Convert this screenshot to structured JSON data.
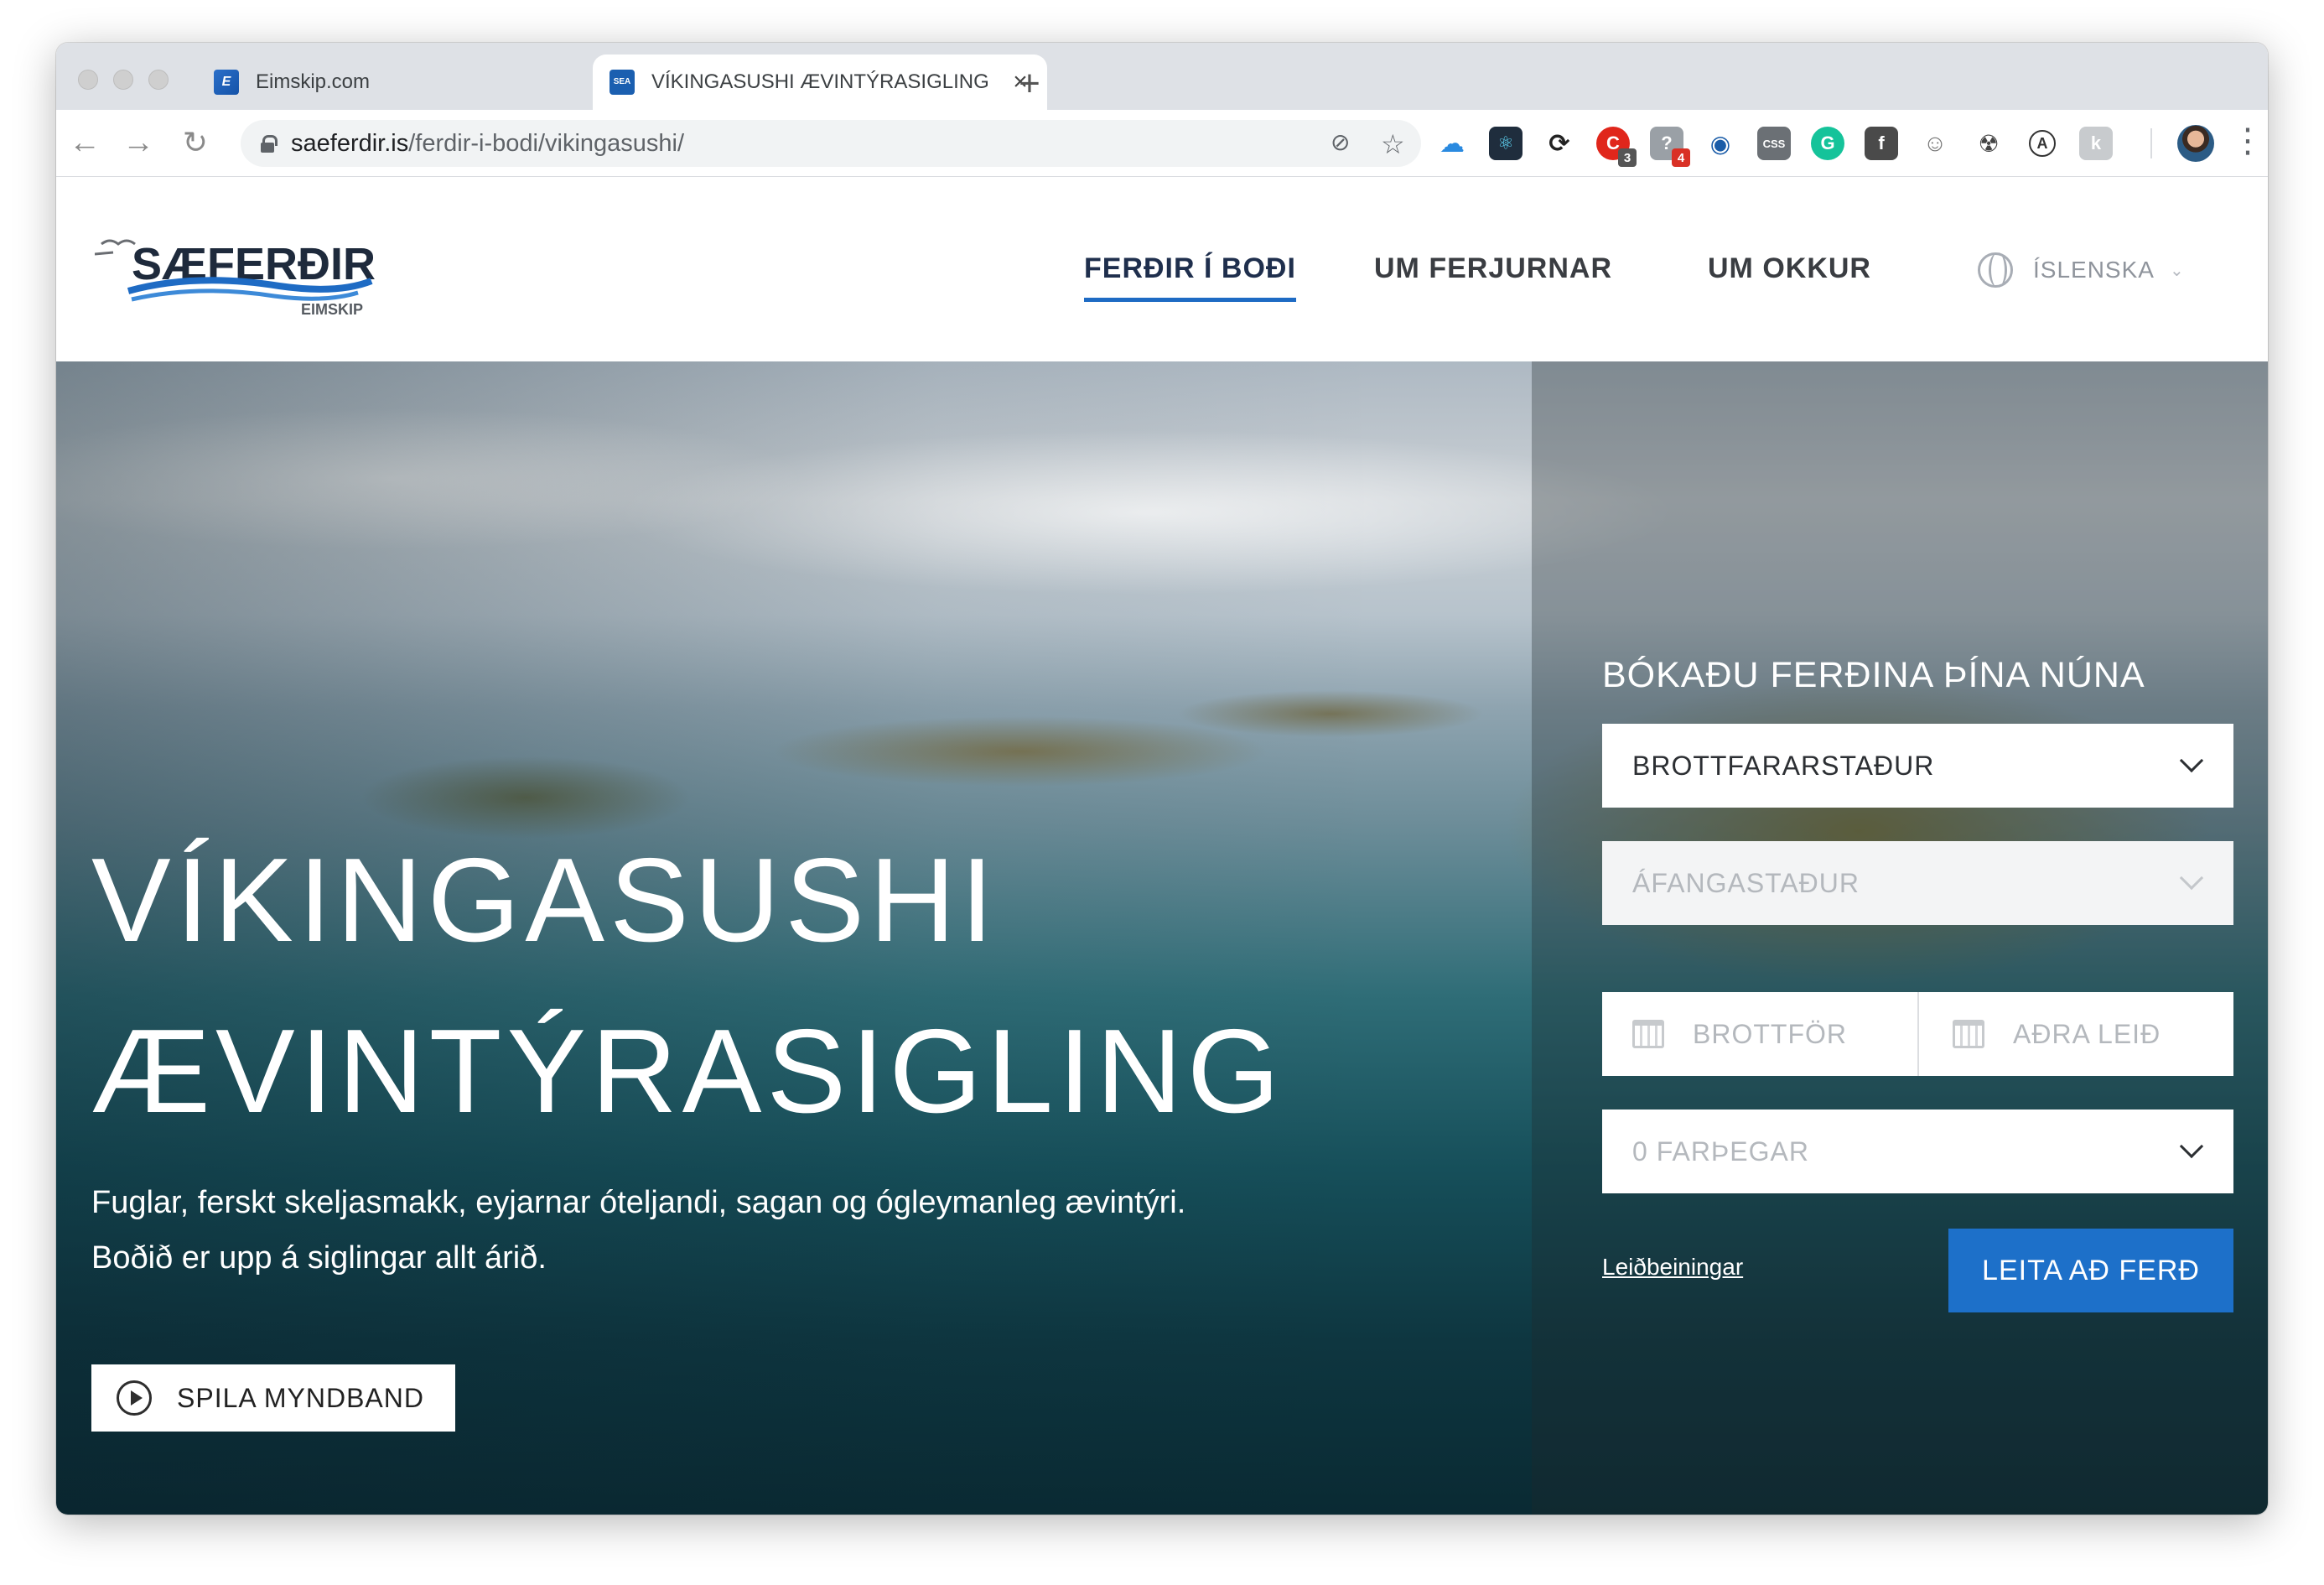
{
  "browser": {
    "tabs": [
      {
        "title": "Eimskip.com",
        "favicon": "eimskip-favicon"
      },
      {
        "title": "VÍKINGASUSHI ÆVINTÝRASIGLING",
        "favicon": "saeferdir-favicon",
        "active": true
      }
    ],
    "favicon_letters": {
      "eimskip": "E",
      "saeferdir": "SEA"
    },
    "url_host": "saeferdir.is",
    "url_path": "/ferdir-i-bodi/vikingasushi/",
    "extension_badges": {
      "ext3": "3",
      "ext4": "4"
    }
  },
  "site": {
    "logo": {
      "wordmark": "SÆFERÐIR",
      "subtext": "EIMSKIP"
    },
    "nav": [
      {
        "label": "FERÐIR Í BOÐI",
        "active": true
      },
      {
        "label": "UM FERJURNAR"
      },
      {
        "label": "UM OKKUR"
      }
    ],
    "language": "ÍSLENSKA"
  },
  "hero": {
    "title_line1": "VÍKINGASUSHI",
    "title_line2": "ÆVINTÝRASIGLING",
    "description_line1": "Fuglar, ferskt skeljasmakk, eyjarnar óteljandi, sagan og ógleymanleg ævintýri.",
    "description_line2": "Boðið er upp á siglingar allt árið.",
    "video_button": "SPILA MYNDBAND"
  },
  "booking": {
    "title": "BÓKAÐU FERÐINA ÞÍNA NÚNA",
    "departure_place": "BROTTFARARSTAÐUR",
    "destination": "ÁFANGASTAÐUR",
    "departure_date": "BROTTFÖR",
    "return_date": "AÐRA LEIÐ",
    "passengers": "0 FARÞEGAR",
    "help_link": "Leiðbeiningar",
    "search_button": "LEITA AÐ FERÐ"
  },
  "colors": {
    "accent": "#1d70c9",
    "nav_underline": "#1e6bc4"
  }
}
